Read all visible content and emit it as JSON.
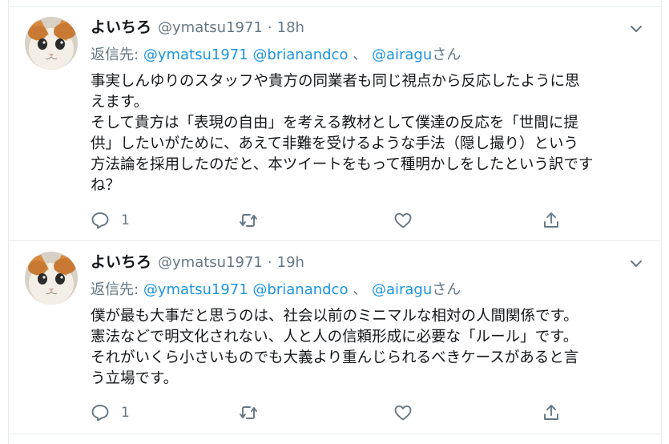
{
  "colors": {
    "accent": "#1b95e0",
    "muted": "#657786",
    "text": "#14171a",
    "border": "#e6ecf0"
  },
  "tweets": [
    {
      "display_name": "よいちろ",
      "handle": "@ymatsu1971",
      "separator": "·",
      "time": "18h",
      "reply_prefix": "返信先:",
      "reply_mentions": [
        "@ymatsu1971",
        "@brianandco"
      ],
      "reply_separator": "、",
      "reply_last": "@airagu",
      "reply_suffix": "さん",
      "text": "事実しんゆりのスタッフや貴方の同業者も同じ視点から反応したように思\nえます。\nそして貴方は「表現の自由」を考える教材として僕達の反応を「世間に提\n供」したいがために、あえて非難を受けるような手法（隠し撮り）という\n方法論を採用したのだと、本ツイートをもって種明かしをしたという訳です\nね？",
      "reply_count": "1",
      "icons": [
        "avatar-cat",
        "chevron-down-icon",
        "reply-icon",
        "retweet-icon",
        "like-icon",
        "share-icon"
      ]
    },
    {
      "display_name": "よいちろ",
      "handle": "@ymatsu1971",
      "separator": "·",
      "time": "19h",
      "reply_prefix": "返信先:",
      "reply_mentions": [
        "@ymatsu1971",
        "@brianandco"
      ],
      "reply_separator": "、",
      "reply_last": "@airagu",
      "reply_suffix": "さん",
      "text": "僕が最も大事だと思うのは、社会以前のミニマルな相対の人間関係です。\n憲法などで明文化されない、人と人の信頼形成に必要な「ルール」です。\nそれがいくら小さいものでも大義より重んじられるべきケースがあると言\nう立場です。",
      "reply_count": "1",
      "icons": [
        "avatar-cat",
        "chevron-down-icon",
        "reply-icon",
        "retweet-icon",
        "like-icon",
        "share-icon"
      ]
    }
  ]
}
